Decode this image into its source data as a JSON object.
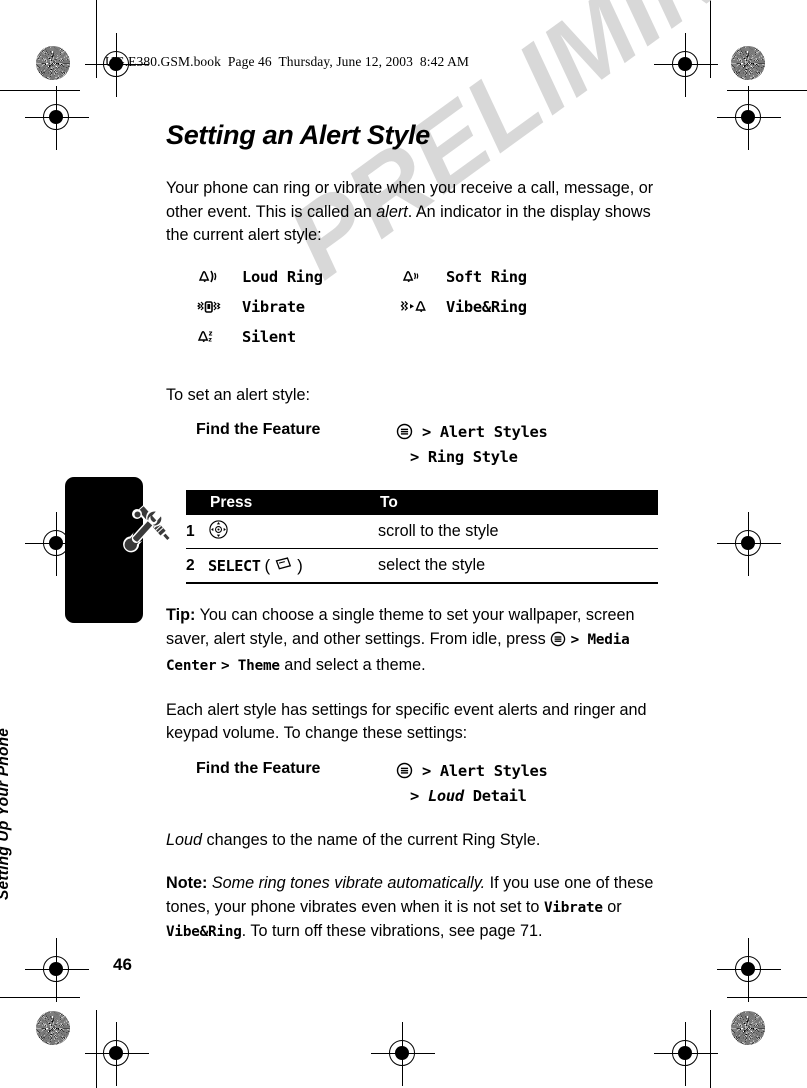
{
  "file_header": "UG.E380.GSM.book  Page 46  Thursday, June 12, 2003  8:42 AM",
  "watermark": "PRELIMINARY",
  "side_tab": {
    "label": "Setting Up Your Phone",
    "icon": "wrench-screwdriver-icon"
  },
  "page_number": "46",
  "title": "Setting an Alert Style",
  "intro": {
    "part1": "Your phone can ring or vibrate when you receive a call, message, or other event. This is called an ",
    "emphasis": "alert",
    "part2": ". An indicator in the display shows the current alert style:"
  },
  "alert_styles": [
    {
      "icon": "bell-loud-ring-icon",
      "name": "Loud Ring"
    },
    {
      "icon": "bell-soft-ring-icon",
      "name": "Soft Ring"
    },
    {
      "icon": "vibrate-icon",
      "name": "Vibrate"
    },
    {
      "icon": "vibrate-and-ring-icon",
      "name": "Vibe&Ring"
    },
    {
      "icon": "bell-silent-icon",
      "name": "Silent"
    }
  ],
  "set_alert_intro": "To set an alert style:",
  "find_feature_1": {
    "label": "Find the Feature",
    "menu_icon": "menu-key-icon",
    "line1": "> Alert Styles",
    "line2": "> Ring Style"
  },
  "steps_table": {
    "headers": {
      "num": "",
      "press": "Press",
      "to": "To"
    },
    "rows": [
      {
        "num": "1",
        "press_icon": "navigation-key-icon",
        "press_text": "",
        "to": "scroll to the style"
      },
      {
        "num": "2",
        "press_icon": "soft-key-icon",
        "press_text": "SELECT",
        "to": "select the style"
      }
    ]
  },
  "tip": {
    "label": "Tip:",
    "part1": " You can choose a single theme to set your wallpaper, screen saver, alert style, and other settings. From idle, press ",
    "menu_icon": "menu-key-icon",
    "path1": "> Media Center",
    "path2": "> Theme",
    "part2": " and select a theme."
  },
  "each_alert_style": "Each alert style has settings for specific event alerts and ringer and keypad volume. To change these settings:",
  "find_feature_2": {
    "label": "Find the Feature",
    "menu_icon": "menu-key-icon",
    "line1": "> Alert Styles",
    "line2_italic": "Loud",
    "line2_rest": "Detail",
    "line2_prefix": ">"
  },
  "loud_note": {
    "italic": "Loud",
    "rest": " changes to the name of the current Ring Style."
  },
  "note": {
    "label": "Note:",
    "italic": " Some ring tones vibrate automatically.",
    "part1": " If you use one of these tones, your phone vibrates even when it is not set to ",
    "mono1": "Vibrate",
    "part2": " or ",
    "mono2": "Vibe&Ring",
    "part3": ". To turn off these vibrations, see page 71."
  }
}
